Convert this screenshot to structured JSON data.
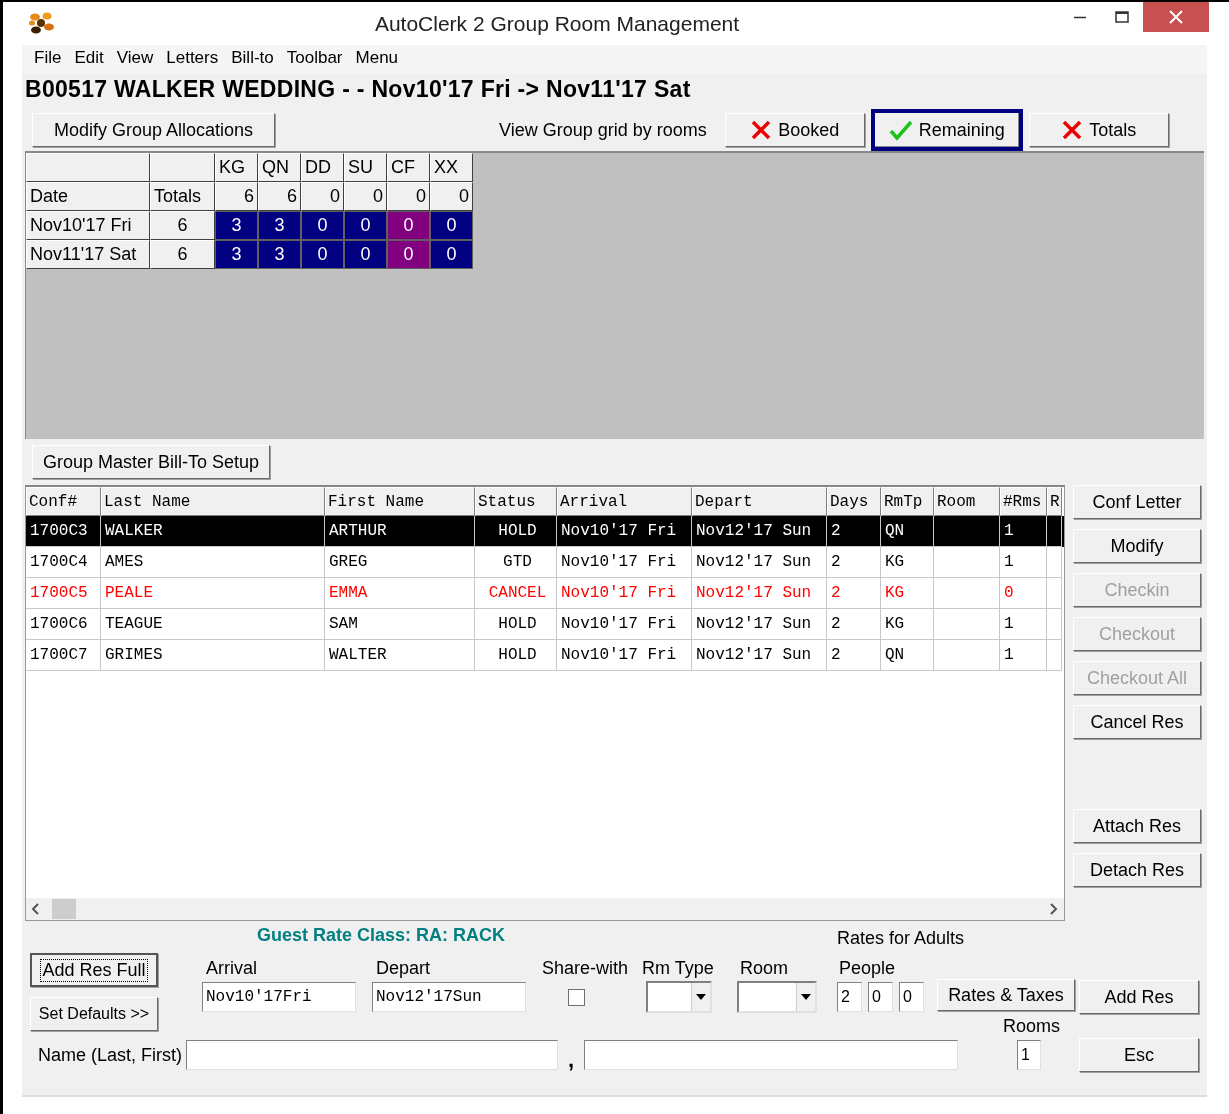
{
  "window": {
    "title": "AutoClerk 2  Group Room Management"
  },
  "menu": [
    "File",
    "Edit",
    "View",
    "Letters",
    "Bill-to",
    "Toolbar",
    "Menu"
  ],
  "header": "B00517 WALKER WEDDING -  - Nov10'17 Fri -> Nov11'17 Sat",
  "allocations_button": "Modify Group Allocations",
  "view_label": "View Group grid by rooms",
  "view_toggles": [
    {
      "label": "Booked",
      "selected": false
    },
    {
      "label": "Remaining",
      "selected": true
    },
    {
      "label": "Totals",
      "selected": false
    }
  ],
  "grid": {
    "room_types": [
      "KG",
      "QN",
      "DD",
      "SU",
      "CF",
      "XX"
    ],
    "date_heading": "Date",
    "totals_heading": "Totals",
    "totals": [
      "6",
      "6",
      "0",
      "0",
      "0",
      "0"
    ],
    "rows": [
      {
        "date": "Nov10'17 Fri",
        "total": "6",
        "cells": [
          {
            "value": "3",
            "color": "#000080"
          },
          {
            "value": "3",
            "color": "#000080"
          },
          {
            "value": "0",
            "color": "#000080"
          },
          {
            "value": "0",
            "color": "#000080"
          },
          {
            "value": "0",
            "color": "#800080"
          },
          {
            "value": "0",
            "color": "#000080"
          }
        ]
      },
      {
        "date": "Nov11'17 Sat",
        "total": "6",
        "cells": [
          {
            "value": "3",
            "color": "#000080"
          },
          {
            "value": "3",
            "color": "#000080"
          },
          {
            "value": "0",
            "color": "#000080"
          },
          {
            "value": "0",
            "color": "#000080"
          },
          {
            "value": "0",
            "color": "#800080"
          },
          {
            "value": "0",
            "color": "#000080"
          }
        ]
      }
    ]
  },
  "bill_to_button": "Group Master Bill-To Setup",
  "table": {
    "columns": [
      "Conf#",
      "Last Name",
      "First Name",
      "Status",
      "Arrival",
      "Depart",
      "Days",
      "RmTp",
      "Room",
      "#Rms",
      "R"
    ],
    "rows": [
      {
        "conf": "1700C3",
        "last_name": "WALKER",
        "first_name": "ARTHUR",
        "status": "HOLD",
        "arrival": "Nov10'17 Fri",
        "depart": "Nov12'17 Sun",
        "days": "2",
        "rmtp": "QN",
        "rms": "1",
        "selected": true,
        "cancelled": false
      },
      {
        "conf": "1700C4",
        "last_name": "AMES",
        "first_name": "GREG",
        "status": "GTD",
        "arrival": "Nov10'17 Fri",
        "depart": "Nov12'17 Sun",
        "days": "2",
        "rmtp": "KG",
        "rms": "1",
        "selected": false,
        "cancelled": false
      },
      {
        "conf": "1700C5",
        "last_name": "PEALE",
        "first_name": "EMMA",
        "status": "CANCEL",
        "arrival": "Nov10'17 Fri",
        "depart": "Nov12'17 Sun",
        "days": "2",
        "rmtp": "KG",
        "rms": "0",
        "selected": false,
        "cancelled": true
      },
      {
        "conf": "1700C6",
        "last_name": "TEAGUE",
        "first_name": "SAM",
        "status": "HOLD",
        "arrival": "Nov10'17 Fri",
        "depart": "Nov12'17 Sun",
        "days": "2",
        "rmtp": "KG",
        "rms": "1",
        "selected": false,
        "cancelled": false
      },
      {
        "conf": "1700C7",
        "last_name": "GRIMES",
        "first_name": "WALTER",
        "status": "HOLD",
        "arrival": "Nov10'17 Fri",
        "depart": "Nov12'17 Sun",
        "days": "2",
        "rmtp": "QN",
        "rms": "1",
        "selected": false,
        "cancelled": false
      }
    ]
  },
  "side_buttons": [
    {
      "label": "Conf Letter",
      "disabled": false
    },
    {
      "label": "Modify",
      "disabled": false
    },
    {
      "label": "Checkin",
      "disabled": true
    },
    {
      "label": "Checkout",
      "disabled": true
    },
    {
      "label": "Checkout All",
      "disabled": true
    },
    {
      "label": "Cancel Res",
      "disabled": false
    },
    {
      "label": "Attach Res",
      "disabled": false
    },
    {
      "label": "Detach Res",
      "disabled": false
    }
  ],
  "form": {
    "rate_class": "Guest Rate Class: RA: RACK",
    "add_full_button": {
      "label": "Add Res Full",
      "focused": true
    },
    "defaults_button": "Set Defaults >>",
    "arrival": {
      "label": "Arrival",
      "value": "Nov10'17Fri"
    },
    "depart": {
      "label": "Depart",
      "value": "Nov12'17Sun"
    },
    "share_with": {
      "label": "Share-with",
      "checked": false
    },
    "rm_type": {
      "label": "Rm Type"
    },
    "room": {
      "label": "Room"
    },
    "rates_label": "Rates for Adults",
    "people_label": "People",
    "people": [
      "2",
      "0",
      "0"
    ],
    "rates_button": "Rates & Taxes",
    "rooms_label": "Rooms",
    "rooms": "1",
    "add_button": "Add Res",
    "esc_button": "Esc",
    "name_label": "Name (Last, First)",
    "name_separator": ","
  }
}
